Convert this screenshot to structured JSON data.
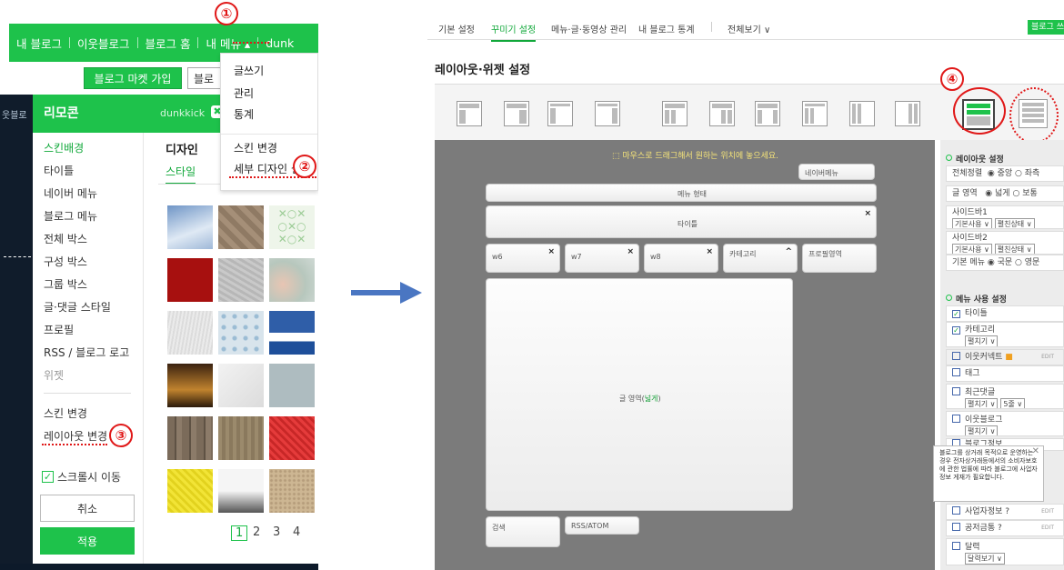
{
  "left_panel": {
    "topnav": [
      "내 블로그",
      "이웃블로그",
      "블로그 홈",
      "내 메뉴 ▴",
      "dunk"
    ],
    "market_button": "블로그 마켓 가입",
    "blog_button": "블로",
    "dark_strip_text": "웃블로",
    "remocon_title": "리모콘",
    "remocon_user": "dunkkick",
    "sidebar_items": [
      "스킨배경",
      "타이틀",
      "네이버 메뉴",
      "블로그 메뉴",
      "전체 박스",
      "구성 박스",
      "그룹 박스",
      "글·댓글 스타일",
      "프로필",
      "RSS / 블로그 로고",
      "위젯",
      "스킨 변경",
      "레이아웃 변경"
    ],
    "scroll_move_label": "스크롤시 이동",
    "cancel_label": "취소",
    "apply_label": "적용",
    "design_heading": "디자인",
    "style_tab": "스타일",
    "pages": [
      "1",
      "2",
      "3",
      "4"
    ],
    "dropdown_items": [
      "글쓰기",
      "관리",
      "통계",
      "스킨 변경",
      "세부 디자인 설정"
    ]
  },
  "badges": [
    "①",
    "②",
    "③",
    "④"
  ],
  "right_panel": {
    "tabs": [
      "기본 설정",
      "꾸미기 설정",
      "메뉴·글·동영상 관리",
      "내 블로그 통계",
      "전체보기 ∨"
    ],
    "top_button": "블로그 쓰",
    "title": "레이아웃·위젯 설정",
    "canvas_note": "마우스로 드래그해서 원하는 위치에 놓으세요.",
    "widgets": {
      "naver_menu": "네이버메뉴",
      "menu_area": "메뉴 형태",
      "title": "타이틀",
      "w6": "w6",
      "w7": "w7",
      "w8": "w8",
      "category": "카테고리",
      "profile": "프로필영역",
      "content_prefix": "글 영역(",
      "content_link": "넓게",
      "content_suffix": ")",
      "search": "검색",
      "rss": "RSS/ATOM"
    },
    "sidebar": {
      "layout_header": "레이아웃 설정",
      "align_label": "전체정렬",
      "align_center": "중앙",
      "align_left": "좌측",
      "content_label": "글 영역",
      "content_wide": "넓게",
      "content_normal": "보통",
      "sidebar1_label": "사이드바1",
      "sidebar2_label": "사이드바2",
      "select_default": "기본사용 ∨",
      "select_state": "펼친상태 ∨",
      "basic_menu_label": "기본 메뉴",
      "lang_ko": "국문",
      "lang_en": "영문",
      "menu_header": "메뉴 사용 설정",
      "menu_items": [
        "타이틀",
        "카테고리",
        "이웃커넥트",
        "태그",
        "최근댓글",
        "이웃블로그",
        "블로그정보",
        "사업자정보",
        "공저금통",
        "달력"
      ],
      "expand_select": "펼치기 ∨",
      "count_select": "5줄 ∨",
      "calendar_select": "달력보기 ∨",
      "edit": "EDIT"
    },
    "tooltip": "블로그를 상거래 목적으로 운영하는 경우 전자상거래등에서의 소비자보호에 관한 법률에 따라 블로그에 사업자 정보 게재가 필요합니다."
  }
}
